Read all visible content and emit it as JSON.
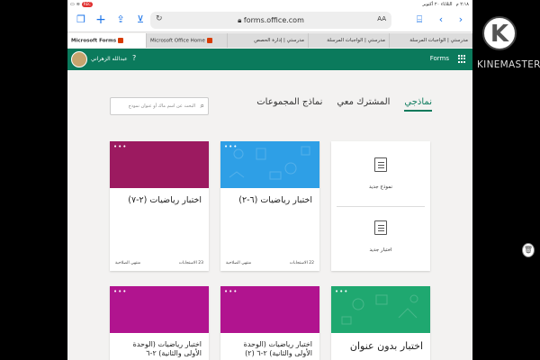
{
  "statusbar": {
    "time": "٢:١٨ م",
    "date": "الثلاثاء ٢٠ أكتوبر",
    "rec": "REC"
  },
  "browser": {
    "url": "forms.office.com",
    "text_size_label": "AA",
    "tabs": [
      {
        "label": "Microsoft Forms",
        "active": true
      },
      {
        "label": "Microsoft Office Home",
        "active": false
      },
      {
        "label": "مدرستي | إدارة الحصص",
        "active": false
      },
      {
        "label": "مدرستي | الواجبات المرسلة",
        "active": false
      },
      {
        "label": "مدرستي | الواجبات المرسلة",
        "active": false
      }
    ]
  },
  "appbar": {
    "user_name": "عبدالله الزهراني",
    "app_name": "Forms",
    "help": "?"
  },
  "pivots": [
    {
      "label": "نماذجي",
      "active": true
    },
    {
      "label": "المشترك معي",
      "active": false
    },
    {
      "label": "نماذج المجموعات",
      "active": false
    }
  ],
  "search": {
    "placeholder": "البحث عن اسم ماك أو عنوان نموذج"
  },
  "new_card": {
    "new_form": "نموذج جديد",
    "new_quiz": "اختبار جديد"
  },
  "cards": [
    {
      "title": "اختبار رياضيات (٦-٢)",
      "responses": "22 الاستجابات",
      "status": "منتهي الصلاحية",
      "color": "#2e9fe6"
    },
    {
      "title": "اختبار رياضيات (٢-٧)",
      "responses": "23 الاستجابات",
      "status": "منتهي الصلاحية",
      "color": "#9c1a60"
    },
    {
      "title": "اختبار بدون عنوان",
      "color": "#1fa870"
    },
    {
      "title": "اختبار رياضيات (الوحدة الأولى والثانية) ٢-٦ (٢)",
      "color": "#b1148f"
    },
    {
      "title": "اختبار رياضيات (الوحدة الأولى والثانية) ٢-٦",
      "color": "#b1148f"
    }
  ],
  "watermark": {
    "logo_letter": "K",
    "text": "KINEMASTER"
  },
  "colors": {
    "brand": "#0b7a5c",
    "accent": "#1a73e8"
  }
}
